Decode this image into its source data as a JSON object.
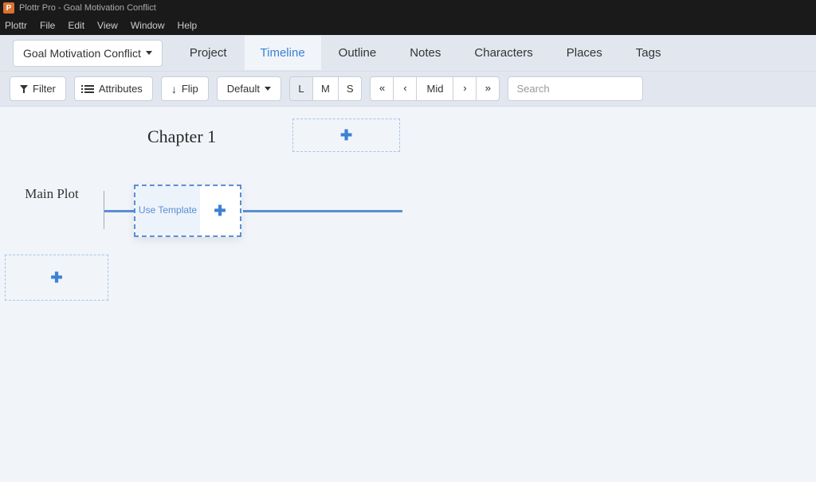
{
  "titlebar": {
    "app_name": "Plottr Pro",
    "document_name": "Goal Motivation Conflict",
    "full_title": "Plottr Pro - Goal Motivation Conflict",
    "icon_letter": "P"
  },
  "menubar": [
    "Plottr",
    "File",
    "Edit",
    "View",
    "Window",
    "Help"
  ],
  "project_dropdown": "Goal Motivation Conflict",
  "navtabs": [
    {
      "label": "Project",
      "active": false
    },
    {
      "label": "Timeline",
      "active": true
    },
    {
      "label": "Outline",
      "active": false
    },
    {
      "label": "Notes",
      "active": false
    },
    {
      "label": "Characters",
      "active": false
    },
    {
      "label": "Places",
      "active": false
    },
    {
      "label": "Tags",
      "active": false
    }
  ],
  "toolbar": {
    "filter_label": "Filter",
    "attributes_label": "Attributes",
    "flip_label": "Flip",
    "default_label": "Default",
    "size_group": [
      "L",
      "M",
      "S"
    ],
    "size_active": "L",
    "nav_group": {
      "first": "«",
      "prev": "‹",
      "mid": "Mid",
      "next": "›",
      "last": "»"
    },
    "search_placeholder": "Search"
  },
  "timeline": {
    "chapter_title": "Chapter 1",
    "plotline_name": "Main Plot",
    "template_button": "Use Template"
  }
}
